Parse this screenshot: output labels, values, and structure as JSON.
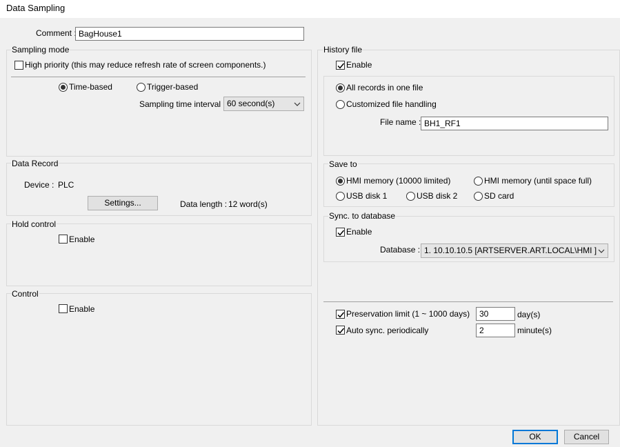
{
  "window": {
    "title": "Data Sampling"
  },
  "comment": {
    "label": "Comment :",
    "value": "BagHouse1"
  },
  "sampling_mode": {
    "title": "Sampling mode",
    "high_priority": {
      "label": "High priority (this may reduce refresh rate of screen components.)",
      "checked": false
    },
    "time_based": {
      "label": "Time-based",
      "selected": true
    },
    "trigger_based": {
      "label": "Trigger-based",
      "selected": false
    },
    "interval_label": "Sampling time interval  :",
    "interval_value": "60 second(s)"
  },
  "data_record": {
    "title": "Data Record",
    "device_label": "Device :",
    "device_value": "PLC",
    "settings_button": "Settings...",
    "length_label": "Data length :",
    "length_value": "12 word(s)"
  },
  "hold_control": {
    "title": "Hold control",
    "enable_label": "Enable",
    "enabled": false
  },
  "control": {
    "title": "Control",
    "enable_label": "Enable",
    "enabled": false
  },
  "history_file": {
    "title": "History file",
    "enable_label": "Enable",
    "enabled": true,
    "all_records_label": "All records in one file",
    "all_records_selected": true,
    "customized_label": "Customized file handling",
    "customized_selected": false,
    "file_name_label": "File name :",
    "file_name_value": "BH1_RF1"
  },
  "save_to": {
    "title": "Save to",
    "options": {
      "hmi_limited": "HMI memory (10000 limited)",
      "hmi_full": "HMI memory (until space full)",
      "usb1": "USB disk 1",
      "usb2": "USB disk 2",
      "sd": "SD card"
    },
    "selected": "hmi_limited"
  },
  "sync_db": {
    "title": "Sync. to database",
    "enable_label": "Enable",
    "enabled": true,
    "database_label": "Database :",
    "database_value": "1. 10.10.10.5 [ARTSERVER.ART.LOCAL\\HMI ]"
  },
  "preservation": {
    "label": "Preservation limit (1 ~ 1000 days)",
    "checked": true,
    "value": "30",
    "unit": "day(s)"
  },
  "auto_sync": {
    "label": "Auto sync. periodically",
    "checked": true,
    "value": "2",
    "unit": "minute(s)"
  },
  "buttons": {
    "ok": "OK",
    "cancel": "Cancel"
  },
  "colors": {
    "accent": "#0078d7",
    "background": "#f0f0f0"
  }
}
